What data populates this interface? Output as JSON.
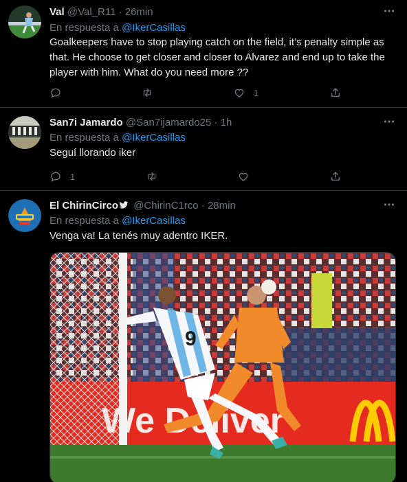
{
  "tweets": [
    {
      "name": "Val",
      "handle": "@Val_R11",
      "dot": "·",
      "time": "26min",
      "reply_prefix": "En respuesta a",
      "reply_mention": "@IkerCasillas",
      "text": "Goalkeepers have to stop playing catch on the field, it’s penalty simple as that. He choose to get closer and closer to Alvarez and end up to take the player with him. What do you need more ??",
      "replies": "",
      "retweets": "",
      "likes": "1"
    },
    {
      "name": "San7i Jamardo",
      "handle": "@San7ijamardo25",
      "dot": "·",
      "time": "1h",
      "reply_prefix": "En respuesta a",
      "reply_mention": "@IkerCasillas",
      "text": "Seguí llorando iker",
      "replies": "1",
      "retweets": "",
      "likes": ""
    },
    {
      "name": "El ChirinCirco",
      "handle": "@ChirinC1rco",
      "dot": "·",
      "time": "28min",
      "reply_prefix": "En respuesta a",
      "reply_mention": "@IkerCasillas",
      "text": "Venga va! La tenés muy adentro IKER.",
      "media_banner": "We Deliver",
      "media_jersey": "9"
    }
  ],
  "colors": {
    "background": "#000000",
    "text": "#e7e9ea",
    "muted": "#71767b",
    "link": "#1d9bf0",
    "divider": "#2f3336"
  }
}
